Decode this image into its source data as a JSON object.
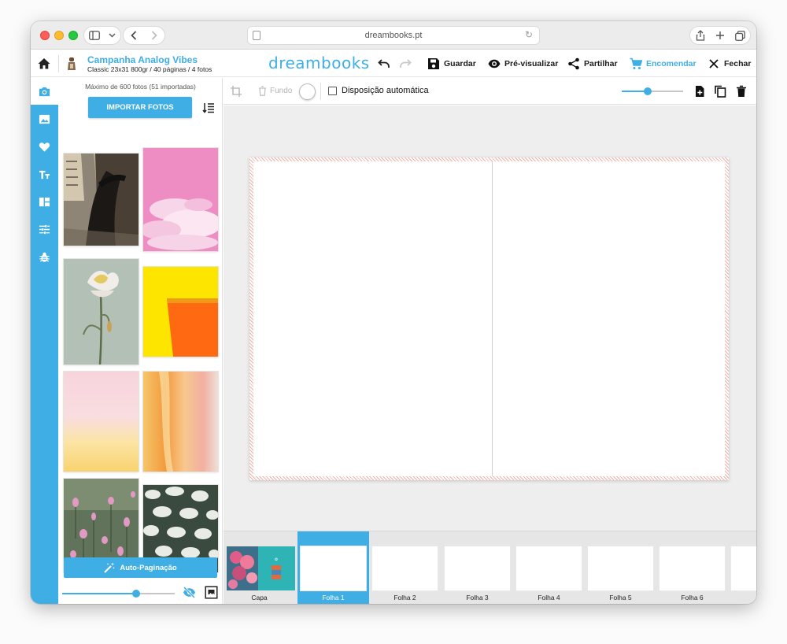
{
  "browser": {
    "url": "dreambooks.pt"
  },
  "header": {
    "project_title": "Campanha Analog Vibes",
    "project_subtitle": "Classic 23x31 800gr / 40 páginas / 4 fotos",
    "logo": "dreambooks",
    "actions": {
      "save": "Guardar",
      "preview": "Pré-visualizar",
      "share": "Partilhar",
      "order": "Encomendar",
      "close": "Fechar"
    },
    "accent_color": "#3eaee5"
  },
  "rail": {
    "items": [
      "camera-icon",
      "image-icon",
      "heart-icon",
      "text-icon",
      "layout-icon",
      "adjust-icon",
      "bug-icon"
    ],
    "active_index": 0
  },
  "photos_panel": {
    "note": "Máximo de 600 fotos (51 importadas)",
    "import_label": "IMPORTAR FOTOS",
    "autopaginate_label": "Auto-Paginação",
    "thumbnail_size": 0.66,
    "photos": [
      {
        "name": "city-motion-photo"
      },
      {
        "name": "pink-sky-photo"
      },
      {
        "name": "iris-flower-photo"
      },
      {
        "name": "yellow-orange-photo"
      },
      {
        "name": "pink-yellow-haze-photo"
      },
      {
        "name": "orange-blur-photo"
      },
      {
        "name": "pink-flowers-photo"
      },
      {
        "name": "white-flowers-photo"
      }
    ]
  },
  "editor_toolbar": {
    "background_label": "Fundo",
    "auto_layout_label": "Disposição automática",
    "auto_layout_checked": false,
    "zoom_level": 0.42
  },
  "pages_strip": {
    "sheets": [
      {
        "label": "Capa",
        "active": false
      },
      {
        "label": "Folha 1",
        "active": true
      },
      {
        "label": "Folha 2",
        "active": false
      },
      {
        "label": "Folha 3",
        "active": false
      },
      {
        "label": "Folha 4",
        "active": false
      },
      {
        "label": "Folha 5",
        "active": false
      },
      {
        "label": "Folha 6",
        "active": false
      }
    ]
  }
}
